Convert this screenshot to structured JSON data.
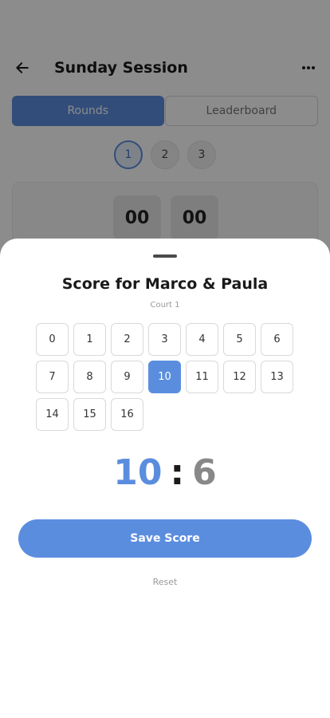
{
  "header": {
    "title": "Sunday Session",
    "back_icon": "arrow-left-icon",
    "more_icon": "more-horizontal-icon"
  },
  "tabs": [
    {
      "label": "Rounds",
      "active": true
    },
    {
      "label": "Leaderboard",
      "active": false
    }
  ],
  "rounds": [
    {
      "label": "1",
      "active": true
    },
    {
      "label": "2",
      "active": false
    },
    {
      "label": "3",
      "active": false
    }
  ],
  "timer": {
    "minutes": "00",
    "seconds": "00"
  },
  "sheet": {
    "title": "Score for Marco & Paula",
    "subtitle": "Court 1",
    "numbers": [
      "0",
      "1",
      "2",
      "3",
      "4",
      "5",
      "6",
      "7",
      "8",
      "9",
      "10",
      "11",
      "12",
      "13",
      "14",
      "15",
      "16"
    ],
    "selected": "10",
    "score_a": "10",
    "separator": ":",
    "score_b": "6",
    "save_label": "Save Score",
    "reset_label": "Reset"
  },
  "colors": {
    "accent": "#5b8ddf",
    "overlay": "rgba(0,0,0,0.45)"
  }
}
